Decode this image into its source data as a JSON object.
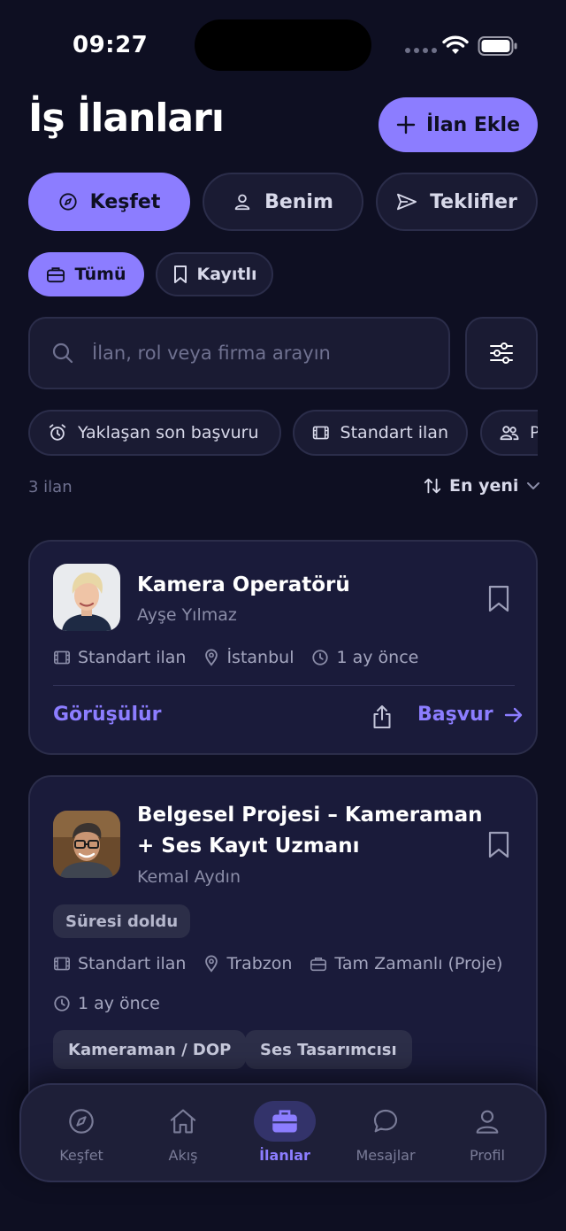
{
  "status_bar": {
    "time": "09:27"
  },
  "header": {
    "title": "İş İlanları",
    "add_button": "İlan Ekle"
  },
  "segments": [
    {
      "label": "Keşfet",
      "active": true
    },
    {
      "label": "Benim",
      "active": false
    },
    {
      "label": "Teklifler",
      "active": false
    }
  ],
  "chips": [
    {
      "label": "Tümü",
      "active": true
    },
    {
      "label": "Kayıtlı",
      "active": false
    }
  ],
  "search": {
    "placeholder": "İlan, rol veya firma arayın"
  },
  "quick_filters": [
    "Yaklaşan son başvuru",
    "Standart ilan",
    "P"
  ],
  "results": {
    "count": "3 ilan",
    "sort": "En yeni"
  },
  "jobs": [
    {
      "title": "Kamera Operatörü",
      "owner": "Ayşe Yılmaz",
      "type": "Standart ilan",
      "location": "İstanbul",
      "posted": "1 ay önce",
      "price": "Görüşülür",
      "apply": "Başvur"
    },
    {
      "title_line1": "Belgesel Projesi – Kameraman",
      "title_line2": "+ Ses Kayıt Uzmanı",
      "owner": "Kemal Aydın",
      "status": "Süresi doldu",
      "type": "Standart ilan",
      "location": "Trabzon",
      "employment": "Tam Zamanlı (Proje)",
      "posted": "1 ay önce",
      "tags": [
        "Kameraman / DOP",
        "Ses Tasarımcısı"
      ]
    }
  ],
  "tabbar": [
    {
      "label": "Keşfet",
      "icon": "compass-icon",
      "active": false
    },
    {
      "label": "Akış",
      "icon": "home-icon",
      "active": false
    },
    {
      "label": "İlanlar",
      "icon": "briefcase-icon",
      "active": true
    },
    {
      "label": "Mesajlar",
      "icon": "chat-bubble-icon",
      "active": false
    },
    {
      "label": "Profil",
      "icon": "user-icon",
      "active": false
    }
  ],
  "colors": {
    "accent": "#8c7dff",
    "background": "#0e0f22",
    "card": "#1a1b3a"
  }
}
